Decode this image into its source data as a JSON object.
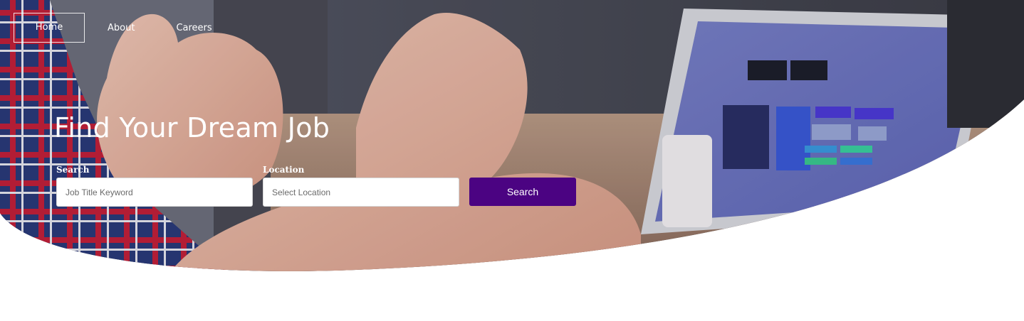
{
  "nav": {
    "items": [
      {
        "label": "Home",
        "active": true
      },
      {
        "label": "About"
      },
      {
        "label": "Careers"
      }
    ]
  },
  "hero": {
    "title": "Find Your Dream Job",
    "background_description_icon": "hero-photo-hands-laptop"
  },
  "search_form": {
    "search_label": "Search",
    "search_placeholder": "Job Title Keyword",
    "location_label": "Location",
    "location_placeholder": "Select Location",
    "button_label": "Search"
  },
  "colors": {
    "accent": "#4b0382",
    "text_on_hero": "#ffffff",
    "page_background": "#ffffff"
  }
}
